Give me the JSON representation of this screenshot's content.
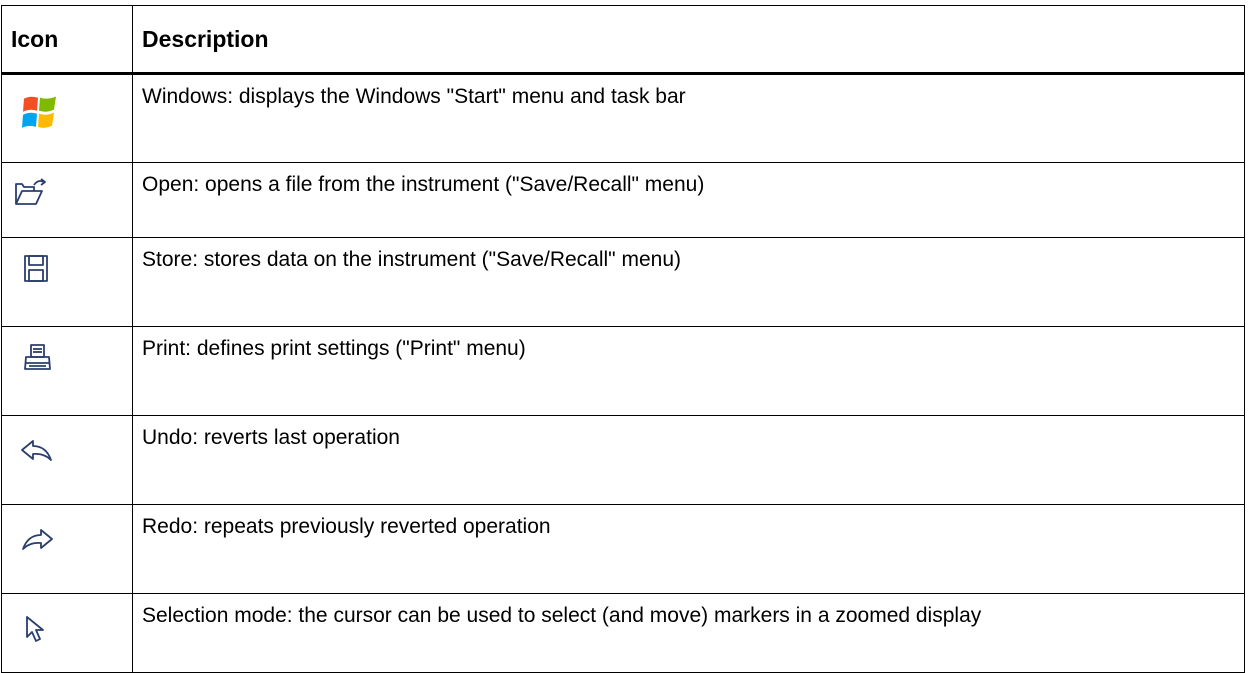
{
  "table": {
    "headers": {
      "icon": "Icon",
      "description": "Description"
    },
    "rows": [
      {
        "icon": "windows-logo-icon",
        "description": "Windows: displays the Windows \"Start\" menu and task bar"
      },
      {
        "icon": "open-folder-icon",
        "description": "Open: opens a file from the instrument (\"Save/Recall\" menu)"
      },
      {
        "icon": "floppy-disk-icon",
        "description": "Store: stores data on the instrument (\"Save/Recall\" menu)"
      },
      {
        "icon": "printer-icon",
        "description": "Print: defines print settings (\"Print\" menu)"
      },
      {
        "icon": "undo-arrow-icon",
        "description": "Undo: reverts last operation"
      },
      {
        "icon": "redo-arrow-icon",
        "description": "Redo: repeats previously reverted operation"
      },
      {
        "icon": "selection-cursor-icon",
        "description": "Selection mode: the cursor can be used to select (and move) markers in a zoomed display"
      }
    ]
  },
  "colors": {
    "border": "#000000",
    "background": "#ffffff",
    "icon_stroke": "#2b3f6e"
  }
}
